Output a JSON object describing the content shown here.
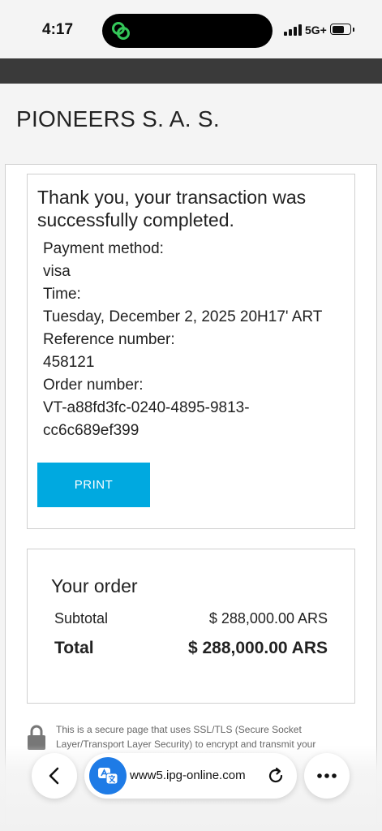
{
  "status_bar": {
    "time": "4:17",
    "network": "5G+"
  },
  "merchant_name": "PIONEERS S. A. S.",
  "confirmation": {
    "heading": "Thank you, your transaction was successfully completed.",
    "payment_method_label": "Payment method:",
    "payment_method_value": "visa",
    "time_label": "Time:",
    "time_value": "Tuesday, December 2, 2025 20H17' ART",
    "reference_label": "Reference number:",
    "reference_value": "458121",
    "order_label": "Order number:",
    "order_value_line1": "VT-a88fd3fc-0240-4895-9813-",
    "order_value_line2": "cc6c689ef399",
    "print_label": "PRINT"
  },
  "order": {
    "title": "Your order",
    "subtotal_label": "Subtotal",
    "subtotal_value": "$ 288,000.00 ARS",
    "total_label": "Total",
    "total_value": "$ 288,000.00 ARS"
  },
  "secure_note": "This is a secure page that uses SSL/TLS (Secure Socket Layer/Transport Layer Security) to encrypt and transmit your",
  "browser": {
    "url": "www5.ipg-online.com"
  },
  "colors": {
    "print_button": "#00a9e0",
    "translate_button": "#1e7be6",
    "dark_band": "#3a3a3a",
    "island_icon": "#34c759"
  }
}
